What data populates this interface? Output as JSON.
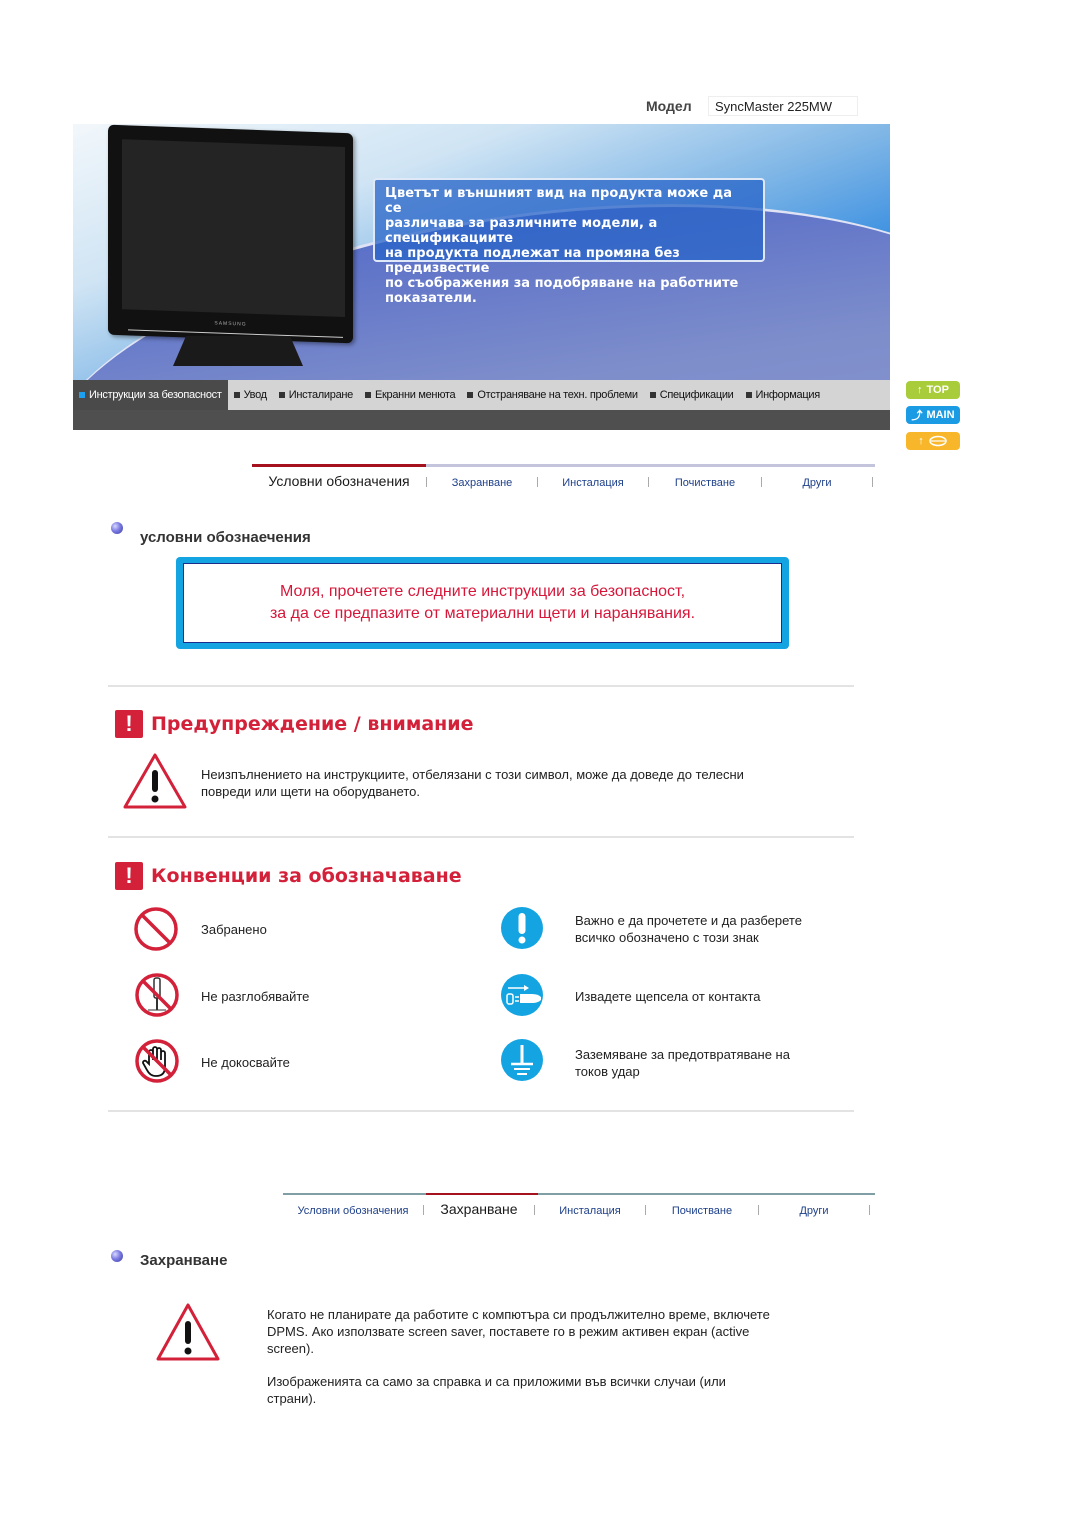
{
  "model": {
    "label": "Модел",
    "value": "SyncMaster 225MW"
  },
  "banner": {
    "notice_lines": [
      "Цветът и външният вид на продукта може да се",
      "различава за различните модели, а спецификациите",
      "на продукта подлежат на промяна без предизвестие",
      "по съображения за подобряване на работните",
      "показатели."
    ],
    "monitor_brand": "SAMSUNG"
  },
  "nav": {
    "items": [
      {
        "label": "Инструкции за безопасност",
        "active": true
      },
      {
        "label": "Увод"
      },
      {
        "label": "Инсталиране"
      },
      {
        "label": "Екранни менюта"
      },
      {
        "label": "Отстраняване на техн. проблеми"
      },
      {
        "label": "Спецификации"
      },
      {
        "label": "Информация"
      }
    ]
  },
  "side_buttons": {
    "top": "TOP",
    "main": "MAIN"
  },
  "tabs_top": {
    "items": [
      "Условни обозначения",
      "Захранване",
      "Инсталация",
      "Почистване",
      "Други"
    ],
    "active": 0
  },
  "section1": {
    "title": "условни обознаечения",
    "read_box": [
      "Моля, прочетете следните инструкции за безопасност,",
      "за да се предпазите от материални щети и наранявания."
    ],
    "warning_heading": "Предупреждение / внимание",
    "warning_text_lines": [
      "Неизпълнението на инструкциите, отбелязани с този символ, може да доведе до телесни",
      "повреди или щети на оборудването."
    ],
    "conventions_heading": "Конвенции за обозначаване",
    "conventions_left": [
      {
        "icon": "prohibited-icon",
        "label": "Забранено"
      },
      {
        "icon": "do-not-disassemble-icon",
        "label": "Не разглобявайте"
      },
      {
        "icon": "do-not-touch-icon",
        "label": "Не докосвайте"
      }
    ],
    "conventions_right": [
      {
        "icon": "important-icon",
        "lines": [
          "Важно е да прочетете и да разберете",
          "всичко обозначено с този знак"
        ]
      },
      {
        "icon": "unplug-icon",
        "lines": [
          "Извадете щепсела от контакта"
        ]
      },
      {
        "icon": "ground-icon",
        "lines": [
          "Заземяване за предотвратяване на",
          "токов удар"
        ]
      }
    ]
  },
  "tabs_bottom": {
    "items": [
      "Условни обозначения",
      "Захранване",
      "Инсталация",
      "Почистване",
      "Други"
    ],
    "active": 1
  },
  "section2": {
    "title": "Захранване",
    "paragraph1_lines": [
      "Когато не планирате да работите с компютъра си продължително време, включете",
      "DPMS. Ако използвате screen saver, поставете го в режим активен екран (active",
      "screen)."
    ],
    "paragraph2_lines": [
      "Изображенията са само за справка и са приложими във всички случаи (или",
      "страни)."
    ]
  },
  "colors": {
    "accent_red": "#d3213a",
    "accent_blue": "#14a4e2",
    "tab_active_line": "#a5121e"
  }
}
